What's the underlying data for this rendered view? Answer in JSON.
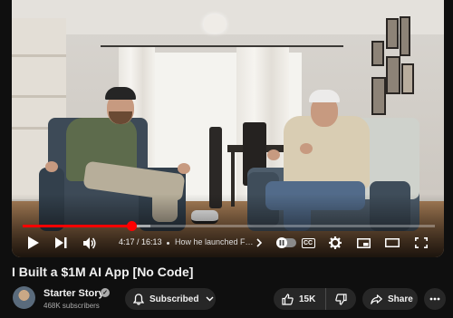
{
  "player": {
    "current_time": "4:17",
    "duration": "16:13",
    "time_separator": " / ",
    "chapter_title": "How he launched For...",
    "progress_played": 0.264,
    "progress_buffered": 0.31,
    "cc_label": "CC"
  },
  "video": {
    "title": "I Built a $1M AI App [No Code]"
  },
  "channel": {
    "name": "Starter Story",
    "subscribers": "468K subscribers"
  },
  "actions": {
    "subscribe_label": "Subscribed",
    "like_count": "15K",
    "share_label": "Share"
  },
  "colors": {
    "background": "#0f0f0f",
    "progress_red": "#ff0000",
    "pill_bg": "#272727"
  },
  "icons": [
    "play-icon",
    "next-icon",
    "volume-icon",
    "chevron-right-icon",
    "autoplay-pause-icon",
    "settings-gear-icon",
    "miniplayer-icon",
    "theater-mode-icon",
    "fullscreen-icon",
    "bell-icon",
    "chevron-down-icon",
    "thumbs-up-icon",
    "thumbs-down-icon",
    "share-arrow-icon",
    "more-dots-icon",
    "verified-check-icon"
  ]
}
